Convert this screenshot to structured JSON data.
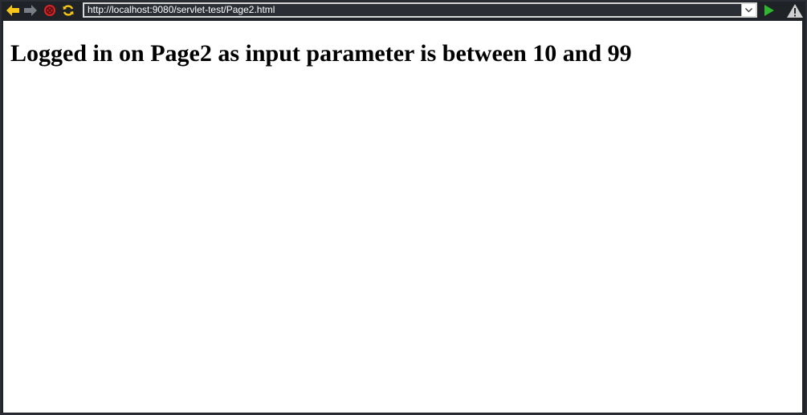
{
  "toolbar": {
    "back_icon": "arrow-left-icon",
    "forward_icon": "arrow-right-icon",
    "stop_icon": "stop-icon",
    "reload_icon": "reload-icon",
    "go_icon": "play-icon",
    "warning_icon": "warning-icon",
    "url": "http://localhost:9080/servlet-test/Page2.html"
  },
  "page": {
    "heading": "Logged in on Page2 as input parameter is between 10 and 99"
  },
  "colors": {
    "chrome_bg": "#1f2227",
    "nav_arrow_active": "#f5c518",
    "nav_arrow_inactive": "#7a7f87",
    "stop_red": "#d9252a",
    "go_green": "#2fb52f",
    "warning_gray": "#cfcfcf"
  }
}
